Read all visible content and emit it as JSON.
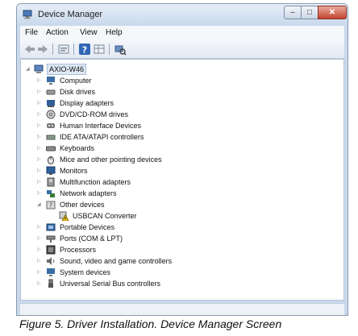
{
  "window": {
    "title": "Device Manager",
    "controls": {
      "minimize": "–",
      "maximize": "□",
      "close": "✕"
    }
  },
  "menu": [
    "File",
    "Action",
    "View",
    "Help"
  ],
  "toolbar": [
    "back-icon",
    "forward-icon",
    "properties-icon",
    "help-icon",
    "grid-icon",
    "scan-hardware-icon"
  ],
  "tree": {
    "root": "AXIO-W46",
    "items": [
      {
        "label": "Computer",
        "icon": "computer-icon",
        "color": "#3a6ea5"
      },
      {
        "label": "Disk drives",
        "icon": "disk-drive-icon",
        "color": "#7d7d7d"
      },
      {
        "label": "Display adapters",
        "icon": "display-adapter-icon",
        "color": "#2f5f9a"
      },
      {
        "label": "DVD/CD-ROM drives",
        "icon": "dvd-drive-icon",
        "color": "#6d6d6d"
      },
      {
        "label": "Human Interface Devices",
        "icon": "hid-icon",
        "color": "#5c5c5c"
      },
      {
        "label": "IDE ATA/ATAPI controllers",
        "icon": "ide-controller-icon",
        "color": "#6c7c6c"
      },
      {
        "label": "Keyboards",
        "icon": "keyboard-icon",
        "color": "#666666"
      },
      {
        "label": "Mice and other pointing devices",
        "icon": "mouse-icon",
        "color": "#555555"
      },
      {
        "label": "Monitors",
        "icon": "monitor-icon",
        "color": "#2f5f9a"
      },
      {
        "label": "Multifunction adapters",
        "icon": "multifunction-icon",
        "color": "#6b6b6b"
      },
      {
        "label": "Network adapters",
        "icon": "network-icon",
        "color": "#3a7a3a"
      },
      {
        "label": "Other devices",
        "icon": "other-devices-icon",
        "color": "#8a8a8a",
        "expanded": true
      },
      {
        "label": "USBCAN Converter",
        "icon": "warning-device-icon",
        "color": "#d6a400",
        "child": true
      },
      {
        "label": "Portable Devices",
        "icon": "portable-device-icon",
        "color": "#3a6ea5"
      },
      {
        "label": "Ports (COM & LPT)",
        "icon": "ports-icon",
        "color": "#707070"
      },
      {
        "label": "Processors",
        "icon": "processor-icon",
        "color": "#4a4a4a"
      },
      {
        "label": "Sound, video and game controllers",
        "icon": "sound-icon",
        "color": "#6a6a6a"
      },
      {
        "label": "System devices",
        "icon": "system-devices-icon",
        "color": "#3a6ea5"
      },
      {
        "label": "Universal Serial Bus controllers",
        "icon": "usb-icon",
        "color": "#555555"
      }
    ]
  },
  "caption": "Figure 5. Driver Installation. Device Manager Screen"
}
